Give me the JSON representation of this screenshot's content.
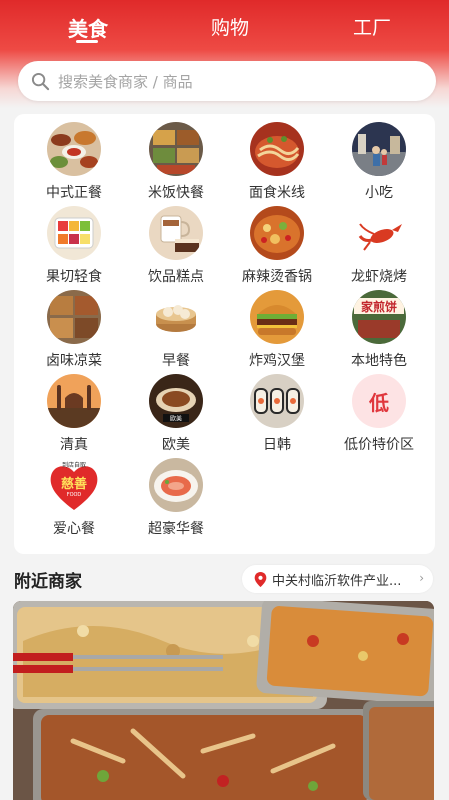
{
  "tabs": [
    {
      "label": "美食",
      "active": true
    },
    {
      "label": "购物",
      "active": false
    },
    {
      "label": "工厂",
      "active": false
    }
  ],
  "search": {
    "placeholder": "搜索美食商家 / 商品",
    "icon": "search-icon"
  },
  "categories": [
    {
      "label": "中式正餐",
      "icon": "chinese-meal-icon"
    },
    {
      "label": "米饭快餐",
      "icon": "rice-fastfood-icon"
    },
    {
      "label": "面食米线",
      "icon": "noodles-icon"
    },
    {
      "label": "小吃",
      "icon": "snack-street-icon"
    },
    {
      "label": "果切轻食",
      "icon": "fruit-cut-icon"
    },
    {
      "label": "饮品糕点",
      "icon": "drink-cake-icon"
    },
    {
      "label": "麻辣烫香锅",
      "icon": "spicy-pot-icon"
    },
    {
      "label": "龙虾烧烤",
      "icon": "lobster-icon"
    },
    {
      "label": "卤味凉菜",
      "icon": "braised-cold-dish-icon"
    },
    {
      "label": "早餐",
      "icon": "breakfast-bun-icon"
    },
    {
      "label": "炸鸡汉堡",
      "icon": "burger-icon"
    },
    {
      "label": "本地特色",
      "icon": "local-special-icon"
    },
    {
      "label": "清真",
      "icon": "mosque-icon"
    },
    {
      "label": "欧美",
      "icon": "western-food-icon"
    },
    {
      "label": "日韩",
      "icon": "sushi-icon"
    },
    {
      "label": "低价特价区",
      "icon": "low-price-icon",
      "badge": "低"
    },
    {
      "label": "爱心餐",
      "icon": "charity-heart-icon",
      "badge_top": "到店自取",
      "badge": "慈善",
      "badge_bottom": "FOOD"
    },
    {
      "label": "超豪华餐",
      "icon": "luxury-plate-icon"
    }
  ],
  "local_special_sign": "家煎饼",
  "western_sign": "欧美",
  "nearby": {
    "title": "附近商家",
    "location": "中关村临沂软件产业...",
    "chevron": "›"
  },
  "colors": {
    "brand_red": "#e02a2a",
    "low_price_pink": "#fde3e4",
    "low_price_text": "#e0373d"
  }
}
